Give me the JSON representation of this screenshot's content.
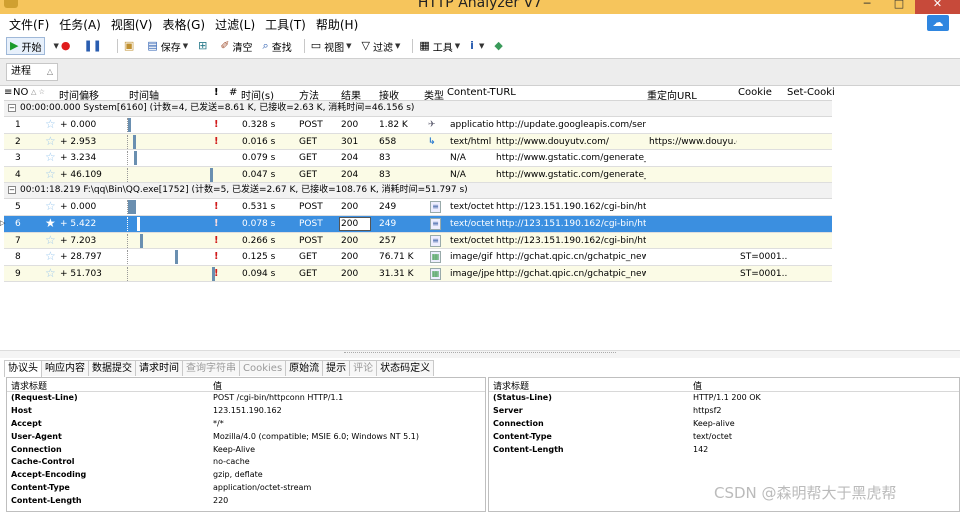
{
  "window": {
    "title": "HTTP Analyzer V7"
  },
  "menu": [
    "文件(F)",
    "任务(A)",
    "视图(V)",
    "表格(G)",
    "过滤(L)",
    "工具(T)",
    "帮助(H)"
  ],
  "toolbar": {
    "start": "开始",
    "save": "保存",
    "clear": "清空",
    "find": "查找",
    "view": "视图",
    "filter": "过滤",
    "tools": "工具"
  },
  "group_by": {
    "label": "进程"
  },
  "columns": {
    "no": "NO",
    "offset": "时间偏移",
    "timeline": "时间轴",
    "excl": "!",
    "hash": "#",
    "time": "时间(s)",
    "method": "方法",
    "result": "结果",
    "received": "接收",
    "type": "类型",
    "content_type": "Content-T",
    "url": "URL",
    "redirect": "重定向URL",
    "cookie": "Cookie",
    "set_cookie": "Set-Cooki"
  },
  "groups": [
    {
      "header": "00:00:00.000   System[6160]  (计数=4, 已发送=8.61 K, 已接收=2.63 K, 消耗时间=46.156 s)",
      "rows": [
        {
          "no": "1",
          "offset": "+ 0.000",
          "time": "0.328 s",
          "method": "POST",
          "result": "200",
          "recv": "1.82 K",
          "ctype": "applicatio...",
          "url": "http://update.googleapis.com/service/...",
          "redirect": "",
          "cookie": "",
          "icon": "plane"
        },
        {
          "no": "2",
          "offset": "+ 2.953",
          "time": "0.016 s",
          "method": "GET",
          "result": "301",
          "recv": "658",
          "ctype": "text/html",
          "url": "http://www.douyutv.com/",
          "redirect": "https://www.douyu.c...",
          "cookie": "",
          "icon": "redirect"
        },
        {
          "no": "3",
          "offset": "+ 3.234",
          "time": "0.079 s",
          "method": "GET",
          "result": "204",
          "recv": "83",
          "ctype": "N/A",
          "url": "http://www.gstatic.com/generate_204",
          "redirect": "",
          "cookie": "",
          "icon": ""
        },
        {
          "no": "4",
          "offset": "+ 46.109",
          "time": "0.047 s",
          "method": "GET",
          "result": "204",
          "recv": "83",
          "ctype": "N/A",
          "url": "http://www.gstatic.com/generate_204",
          "redirect": "",
          "cookie": "",
          "icon": ""
        }
      ]
    },
    {
      "header": "00:01:18.219   F:\\qq\\Bin\\QQ.exe[1752]  (计数=5, 已发送=2.67 K, 已接收=108.76 K, 消耗时间=51.797 s)",
      "rows": [
        {
          "no": "5",
          "offset": "+ 0.000",
          "time": "0.531 s",
          "method": "POST",
          "result": "200",
          "recv": "249",
          "ctype": "text/octet",
          "url": "http://123.151.190.162/cgi-bin/httpconn",
          "redirect": "",
          "cookie": "",
          "icon": "doc"
        },
        {
          "no": "6",
          "offset": "+ 5.422",
          "time": "0.078 s",
          "method": "POST",
          "result": "200",
          "recv": "249",
          "ctype": "text/octet",
          "url": "http://123.151.190.162/cgi-bin/httpconn",
          "redirect": "",
          "cookie": "",
          "icon": "doc"
        },
        {
          "no": "7",
          "offset": "+ 7.203",
          "time": "0.266 s",
          "method": "POST",
          "result": "200",
          "recv": "257",
          "ctype": "text/octet",
          "url": "http://123.151.190.162/cgi-bin/httpconn",
          "redirect": "",
          "cookie": "",
          "icon": "doc"
        },
        {
          "no": "8",
          "offset": "+ 28.797",
          "time": "0.125 s",
          "method": "GET",
          "result": "200",
          "recv": "76.71 K",
          "ctype": "image/gif",
          "url": "http://gchat.qpic.cn/gchatpic_new/EE...",
          "redirect": "",
          "cookie": "ST=0001...",
          "icon": "img"
        },
        {
          "no": "9",
          "offset": "+ 51.703",
          "time": "0.094 s",
          "method": "GET",
          "result": "200",
          "recv": "31.31 K",
          "ctype": "image/jpeg",
          "url": "http://gchat.qpic.cn/gchatpic_new/17...",
          "redirect": "",
          "cookie": "ST=0001...",
          "icon": "img"
        }
      ]
    }
  ],
  "detail_tabs": [
    "协议头",
    "响应内容",
    "数据提交",
    "请求时间",
    "查询字符串",
    "Cookies",
    "原始流",
    "提示",
    "评论",
    "状态码定义"
  ],
  "request_headers": {
    "col_name": "请求标题",
    "col_value": "值",
    "rows": [
      {
        "k": "(Request-Line)",
        "v": "POST /cgi-bin/httpconn HTTP/1.1"
      },
      {
        "k": "Host",
        "v": "123.151.190.162"
      },
      {
        "k": "Accept",
        "v": "*/*"
      },
      {
        "k": "User-Agent",
        "v": "Mozilla/4.0 (compatible; MSIE 6.0; Windows NT 5.1)"
      },
      {
        "k": "Connection",
        "v": "Keep-Alive"
      },
      {
        "k": "Cache-Control",
        "v": "no-cache"
      },
      {
        "k": "Accept-Encoding",
        "v": "gzip, deflate"
      },
      {
        "k": "Content-Type",
        "v": "application/octet-stream"
      },
      {
        "k": "Content-Length",
        "v": "220"
      }
    ]
  },
  "response_headers": {
    "col_name": "请求标题",
    "col_value": "值",
    "rows": [
      {
        "k": "(Status-Line)",
        "v": "HTTP/1.1 200 OK"
      },
      {
        "k": "Server",
        "v": "httpsf2"
      },
      {
        "k": "Connection",
        "v": "Keep-alive"
      },
      {
        "k": "Content-Type",
        "v": "text/octet"
      },
      {
        "k": "Content-Length",
        "v": "142"
      }
    ]
  },
  "watermark": "CSDN @森明帮大于黑虎帮"
}
